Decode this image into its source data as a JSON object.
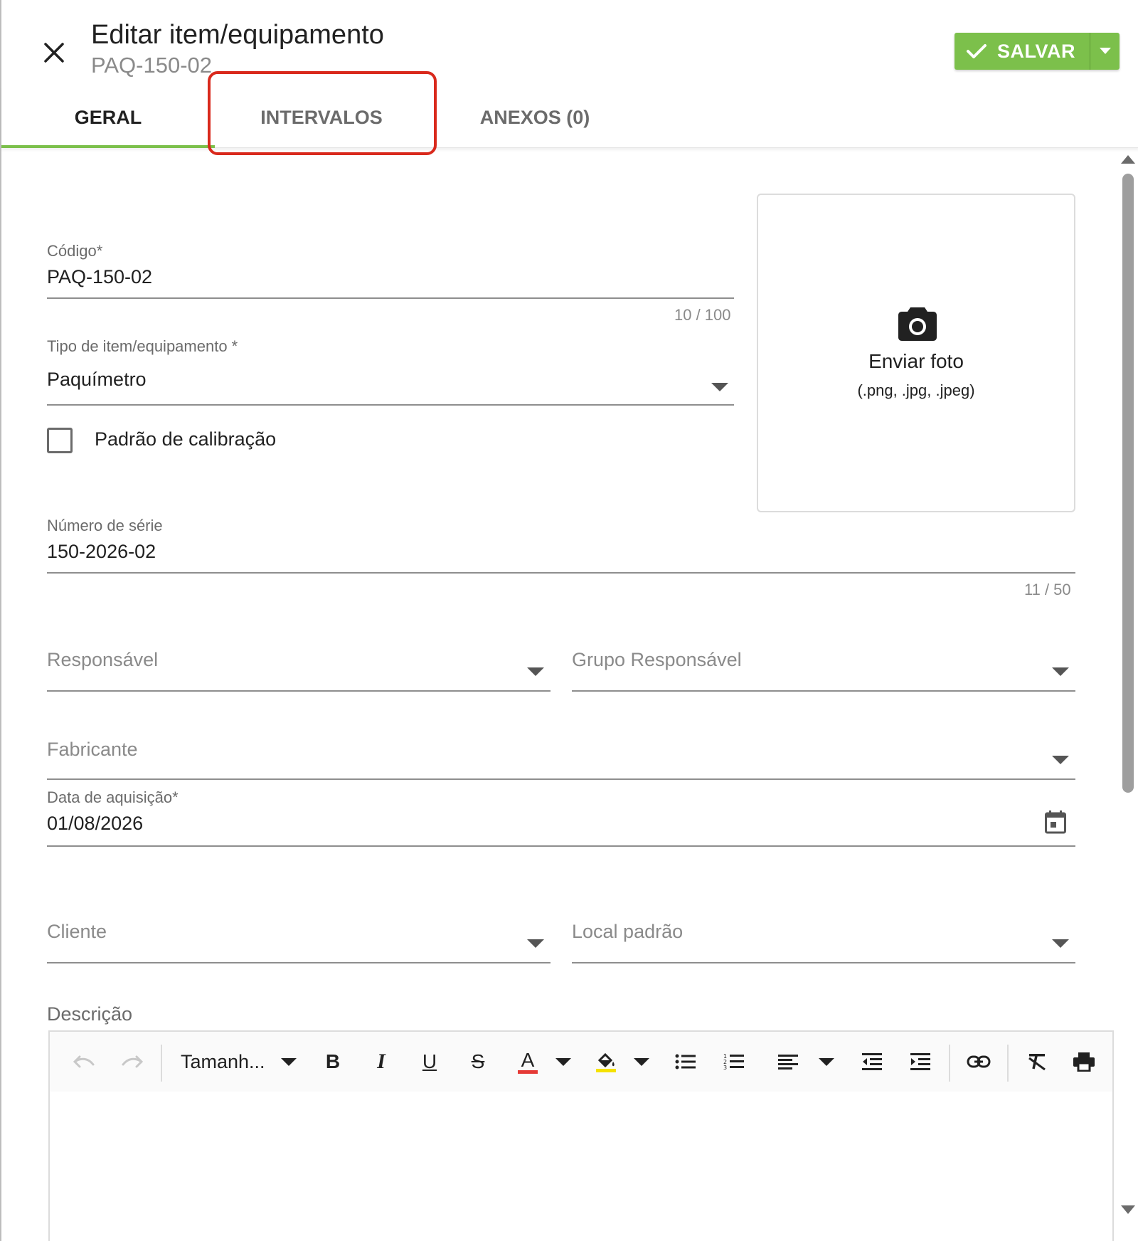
{
  "header": {
    "title": "Editar item/equipamento",
    "subtitle": "PAQ-150-02",
    "save_label": "SALVAR",
    "accent_color": "#7cc04b"
  },
  "tabs": [
    {
      "label": "GERAL",
      "active": true
    },
    {
      "label": "INTERVALOS",
      "active": false,
      "highlighted": true
    },
    {
      "label": "ANEXOS (0)",
      "active": false
    }
  ],
  "form": {
    "codigo": {
      "label": "Código*",
      "value": "PAQ-150-02",
      "counter": "10 / 100"
    },
    "tipo": {
      "label": "Tipo de item/equipamento *",
      "value": "Paquímetro"
    },
    "padrao": {
      "label": "Padrão de calibração",
      "checked": false
    },
    "serie": {
      "label": "Número de série",
      "value": "150-2026-02",
      "counter": "11 / 50"
    },
    "responsavel": {
      "placeholder": "Responsável"
    },
    "grupo_responsavel": {
      "placeholder": "Grupo Responsável"
    },
    "fabricante": {
      "placeholder": "Fabricante"
    },
    "data_aquisicao": {
      "label": "Data de aquisição*",
      "value": "01/08/2026"
    },
    "cliente": {
      "placeholder": "Cliente"
    },
    "local_padrao": {
      "placeholder": "Local padrão"
    },
    "descricao": {
      "label": "Descrição"
    }
  },
  "photo": {
    "title": "Enviar foto",
    "formats": "(.png, .jpg, .jpeg)"
  },
  "editor": {
    "font_size_label": "Tamanh...",
    "font_color": "#e53935",
    "highlight_color": "#f5e200",
    "tools": [
      "undo-icon",
      "redo-icon",
      "bold-icon",
      "italic-icon",
      "underline-icon",
      "strikethrough-icon",
      "font-color-icon",
      "highlight-icon",
      "bullet-list-icon",
      "numbered-list-icon",
      "align-icon",
      "outdent-icon",
      "indent-icon",
      "link-icon",
      "clear-format-icon",
      "print-icon"
    ]
  }
}
